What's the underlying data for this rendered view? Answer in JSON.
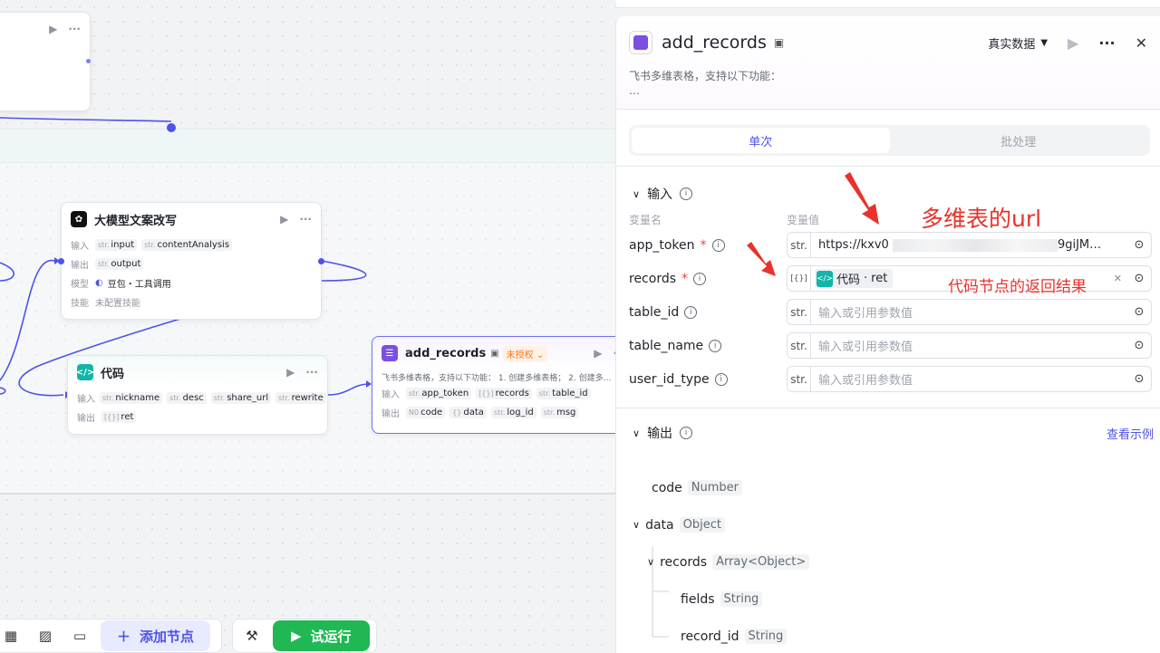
{
  "canvas": {
    "node_llm": {
      "title": "大模型文案改写",
      "rows": [
        {
          "label": "输入",
          "tags": [
            {
              "type": "str.",
              "name": "input"
            },
            {
              "type": "str.",
              "name": "contentAnalysis"
            }
          ]
        },
        {
          "label": "输出",
          "tags": [
            {
              "type": "str.",
              "name": "output"
            }
          ]
        },
        {
          "label": "模型",
          "model": "豆包・工具调用"
        },
        {
          "label": "技能",
          "value": "未配置技能"
        }
      ]
    },
    "node_code": {
      "title": "代码",
      "rows": [
        {
          "label": "输入",
          "tags": [
            {
              "type": "str.",
              "name": "nickname"
            },
            {
              "type": "str.",
              "name": "desc"
            },
            {
              "type": "str.",
              "name": "share_url"
            },
            {
              "type": "str.",
              "name": "rewrite"
            }
          ]
        },
        {
          "label": "输出",
          "tags": [
            {
              "type": "[{}]",
              "name": "ret"
            }
          ]
        }
      ]
    },
    "node_add": {
      "title": "add_records",
      "badge": "未授权",
      "desc": "飞书多维表格，支持以下功能： 1. 创建多维表格； 2. 创建多…",
      "rows": [
        {
          "label": "输入",
          "tags": [
            {
              "type": "str.",
              "name": "app_token"
            },
            {
              "type": "[{}]",
              "name": "records"
            },
            {
              "type": "str.",
              "name": "table_id"
            }
          ]
        },
        {
          "label": "输出",
          "tags": [
            {
              "type": "N0",
              "name": "code"
            },
            {
              "type": "{}",
              "name": "data"
            },
            {
              "type": "str.",
              "name": "log_id"
            },
            {
              "type": "str.",
              "name": "msg"
            }
          ]
        }
      ]
    }
  },
  "toolbar": {
    "add_node": "添加节点",
    "run": "试运行"
  },
  "panel": {
    "title": "add_records",
    "mode": "真实数据",
    "desc_line1": "飞书多维表格，支持以下功能：",
    "desc_line2": "…",
    "tabs": [
      "单次",
      "批处理"
    ],
    "input_title": "输入",
    "col_name": "变量名",
    "col_value": "变量值",
    "params": [
      {
        "name": "app_token",
        "required": true,
        "type": "str.",
        "value": "https://kxv0",
        "value_tail": "9giJM…",
        "placeholder": ""
      },
      {
        "name": "records",
        "required": true,
        "type": "[{}]",
        "ref_node": "代码",
        "ref_field": "ret",
        "placeholder": ""
      },
      {
        "name": "table_id",
        "required": false,
        "type": "str.",
        "placeholder": "输入或引用参数值"
      },
      {
        "name": "table_name",
        "required": false,
        "type": "str.",
        "placeholder": "输入或引用参数值"
      },
      {
        "name": "user_id_type",
        "required": false,
        "type": "str.",
        "placeholder": "输入或引用参数值"
      }
    ],
    "output_title": "输出",
    "view_example": "查看示例",
    "outputs": [
      {
        "name": "code",
        "type": "Number"
      },
      {
        "name": "data",
        "type": "Object"
      },
      {
        "name": "records",
        "type": "Array<Object>"
      },
      {
        "name": "fields",
        "type": "String"
      },
      {
        "name": "record_id",
        "type": "String"
      }
    ]
  },
  "annotations": {
    "url_note": "多维表的url",
    "ret_note": "代码节点的返回结果"
  },
  "colors": {
    "accent": "#4d53e8",
    "run_green": "#1fb852",
    "annotation_red": "#e8322b",
    "code_teal": "#12b5a6",
    "bitable_purple": "#7b4fe0"
  }
}
